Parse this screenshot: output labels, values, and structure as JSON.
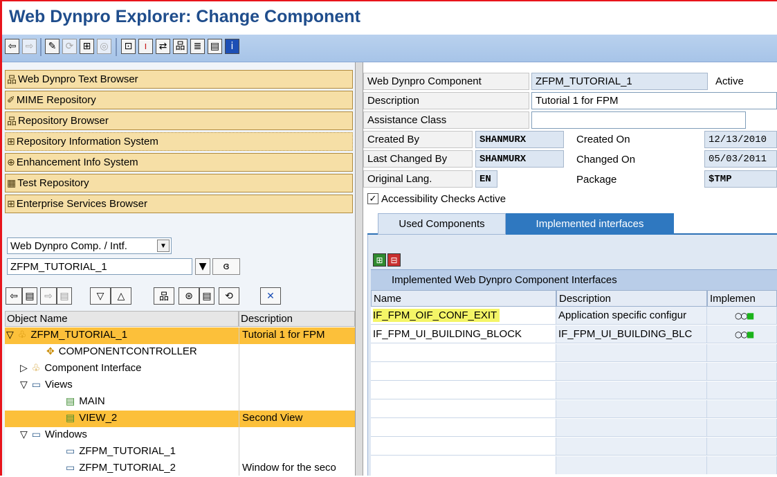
{
  "window": {
    "title": "Web Dynpro Explorer: Change Component"
  },
  "toolbar": {
    "buttons": [
      "back-icon",
      "forward-icon",
      "edit-icon",
      "display-change-icon",
      "other-object-icon",
      "activate-icon",
      "check-icon",
      "info-icon",
      "where-used-icon",
      "hierarchy-icon",
      "object-list-icon",
      "layout-icon",
      "help-icon"
    ]
  },
  "nav_buttons": [
    {
      "label": "Web Dynpro Text Browser",
      "icon": "hierarchy-icon"
    },
    {
      "label": "MIME Repository",
      "icon": "mime-icon"
    },
    {
      "label": "Repository Browser",
      "icon": "hierarchy-icon"
    },
    {
      "label": "Repository Information System",
      "icon": "info-system-icon"
    },
    {
      "label": "Enhancement Info System",
      "icon": "enhancement-icon"
    },
    {
      "label": "Test Repository",
      "icon": "test-repo-icon"
    },
    {
      "label": "Enterprise Services Browser",
      "icon": "services-icon"
    }
  ],
  "object_selector": {
    "type_value": "Web Dynpro Comp. / Intf.",
    "name_value": "ZFPM_TUTORIAL_1"
  },
  "tree": {
    "columns": [
      "Object Name",
      "Description"
    ],
    "rows": [
      {
        "name": "ZFPM_TUTORIAL_1",
        "desc": "Tutorial 1 for FPM"
      },
      {
        "name": "COMPONENTCONTROLLER",
        "desc": ""
      },
      {
        "name": "Component Interface",
        "desc": ""
      },
      {
        "name": "Views",
        "desc": ""
      },
      {
        "name": "MAIN",
        "desc": ""
      },
      {
        "name": "VIEW_2",
        "desc": "Second View"
      },
      {
        "name": "Windows",
        "desc": ""
      },
      {
        "name": "ZFPM_TUTORIAL_1",
        "desc": ""
      },
      {
        "name": "ZFPM_TUTORIAL_2",
        "desc": "Window for the seco"
      }
    ]
  },
  "header": {
    "component_label": "Web Dynpro Component",
    "component_value": "ZFPM_TUTORIAL_1",
    "status": "Active",
    "description_label": "Description",
    "description_value": "Tutorial 1 for FPM",
    "assistance_label": "Assistance Class",
    "assistance_value": "",
    "created_by_label": "Created By",
    "created_by_value": "SHANMURX",
    "created_on_label": "Created On",
    "created_on_value": "12/13/2010",
    "changed_by_label": "Last Changed By",
    "changed_by_value": "SHANMURX",
    "changed_on_label": "Changed On",
    "changed_on_value": "05/03/2011",
    "orig_lang_label": "Original Lang.",
    "orig_lang_value": "EN",
    "package_label": "Package",
    "package_value": "$TMP",
    "accessibility_label": "Accessibility Checks Active",
    "accessibility_checked": true
  },
  "tabs": [
    {
      "label": "Used Components",
      "active": false
    },
    {
      "label": "Implemented interfaces",
      "active": true
    }
  ],
  "interfaces_table": {
    "title": "Implemented Web Dynpro Component Interfaces",
    "columns": [
      "Name",
      "Description",
      "Implemen"
    ],
    "rows": [
      {
        "name": "IF_FPM_OIF_CONF_EXIT",
        "desc": "Application specific configur",
        "status": "green"
      },
      {
        "name": "IF_FPM_UI_BUILDING_BLOCK",
        "desc": "IF_FPM_UI_BUILDING_BLC",
        "status": "green"
      }
    ]
  },
  "colors": {
    "title": "#1f4d8c",
    "toolbar": "#b9d1ee",
    "nav_button": "#f6dfa6",
    "selected_row": "#fcc03a",
    "active_tab": "#2f78c0",
    "highlight": "#f4f567"
  }
}
